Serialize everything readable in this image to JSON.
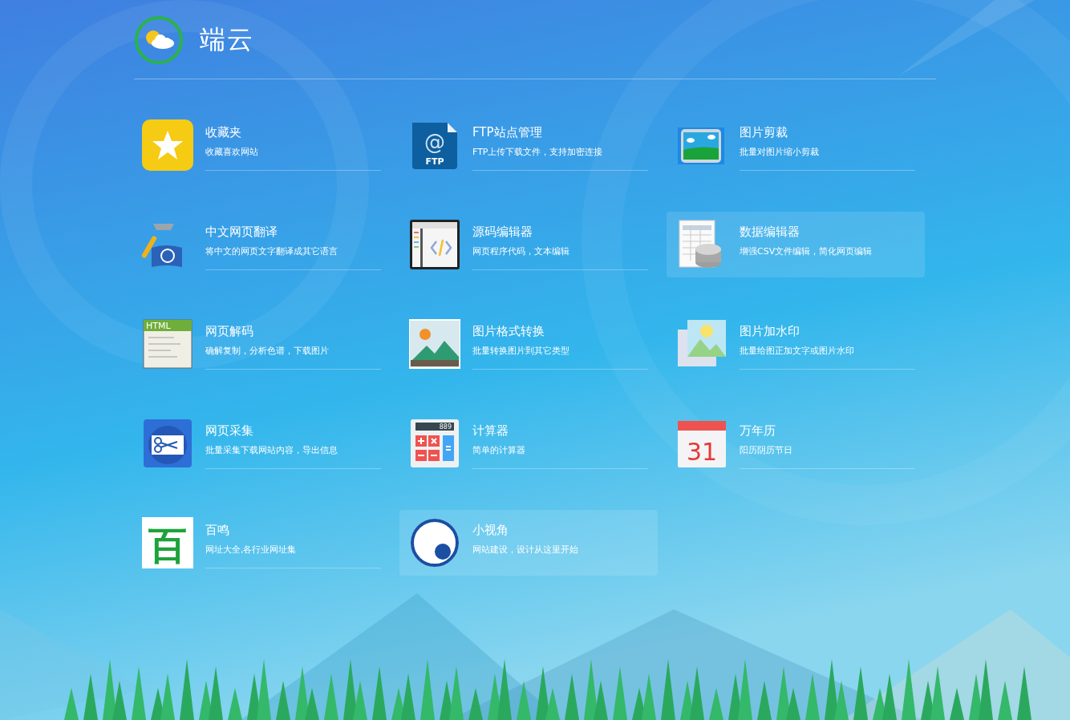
{
  "app": {
    "title": "端云"
  },
  "apps": [
    {
      "kind": "star",
      "title": "收藏夹",
      "description": "收藏喜欢网站",
      "hovered": false
    },
    {
      "kind": "ftp",
      "icon_texts": [
        "@",
        "FTP"
      ],
      "title": "FTP站点管理",
      "description": "FTP上传下载文件，支持加密连接",
      "hovered": false
    },
    {
      "kind": "crop",
      "title": "图片剪裁",
      "description": "批量对图片缩小剪裁",
      "hovered": false
    },
    {
      "kind": "translate",
      "title": "中文网页翻译",
      "description": "将中文的网页文字翻译成其它语言",
      "hovered": false
    },
    {
      "kind": "code",
      "title": "源码编辑器",
      "description": "网页程序代码，文本编辑",
      "hovered": false
    },
    {
      "kind": "database",
      "title": "数据编辑器",
      "description": "增强CSV文件编辑，简化网页编辑",
      "hovered": true
    },
    {
      "kind": "html",
      "icon_texts": [
        "HTML"
      ],
      "title": "网页解码",
      "description": "确解复制，分析色谱，下载图片",
      "hovered": false
    },
    {
      "kind": "landscape",
      "title": "图片格式转换",
      "description": "批量转换图片到其它类型",
      "hovered": false
    },
    {
      "kind": "watermark",
      "title": "图片加水印",
      "description": "批量给图正加文字或图片水印",
      "hovered": false
    },
    {
      "kind": "scissors",
      "title": "网页采集",
      "description": "批量采集下载网站内容，导出信息",
      "hovered": false
    },
    {
      "kind": "calculator",
      "icon_texts": [
        "889"
      ],
      "title": "计算器",
      "description": "简单的计算器",
      "hovered": false
    },
    {
      "kind": "calendar",
      "icon_texts": [
        "31"
      ],
      "title": "万年历",
      "description": "阳历阴历节日",
      "hovered": false
    },
    {
      "kind": "bai",
      "icon_texts": [
        "百"
      ],
      "title": "百鸣",
      "description": "网址大全,各行业网址集",
      "hovered": false
    },
    {
      "kind": "lens",
      "title": "小视角",
      "description": "网站建设，设计从这里开始",
      "hovered": true
    }
  ]
}
